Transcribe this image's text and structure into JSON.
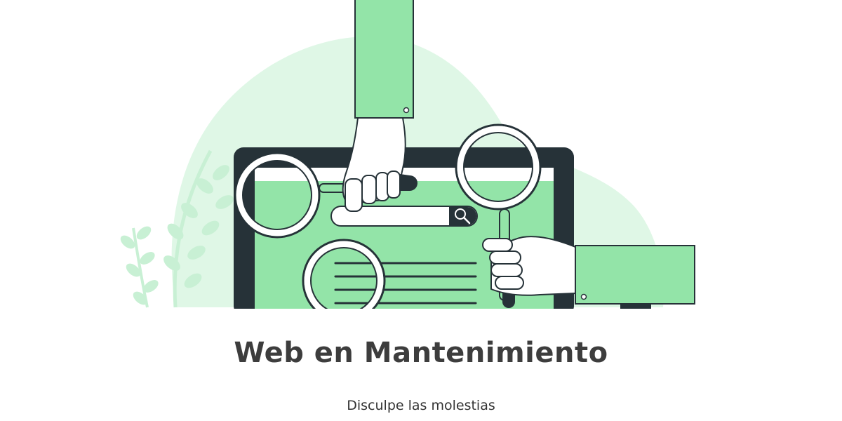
{
  "page": {
    "title": "Web en Mantenimiento",
    "subtitle": "Disculpe las molestias"
  },
  "colors": {
    "accent": "#93e4a8",
    "accent_light": "#dff7e6",
    "outline": "#263238",
    "text_title": "#3d3d3d",
    "text_body": "#333333",
    "background": "#ffffff"
  },
  "icons": {
    "illustration": "maintenance-illustration",
    "magnifier": "search-icon"
  }
}
